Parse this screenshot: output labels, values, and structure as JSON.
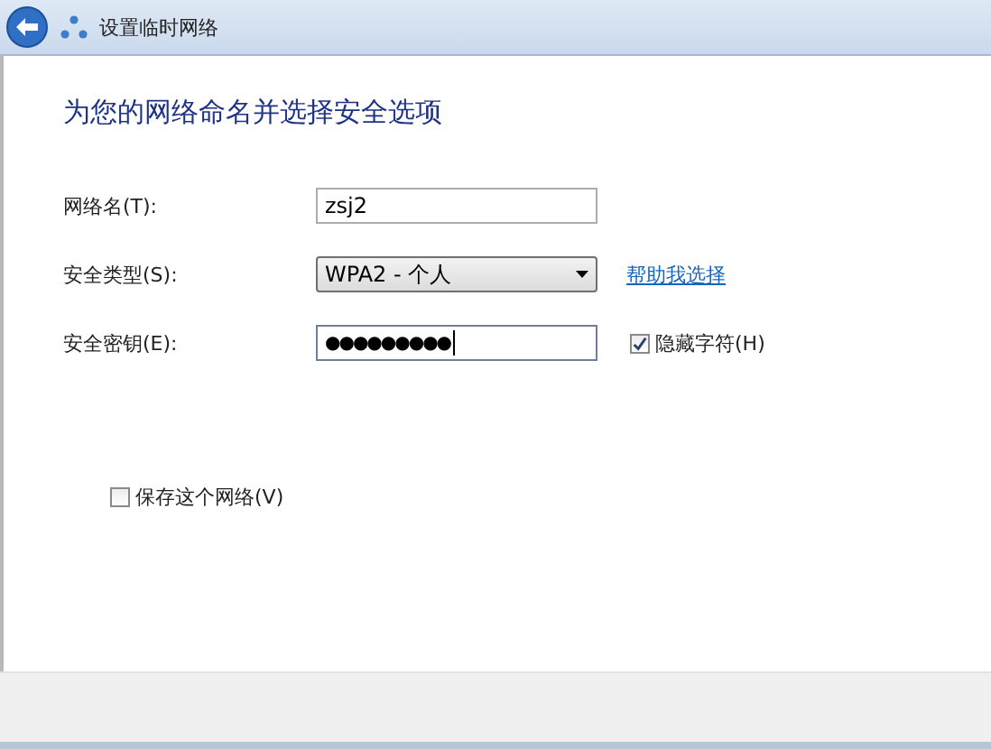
{
  "window": {
    "title": "设置临时网络"
  },
  "heading": "为您的网络命名并选择安全选项",
  "fields": [
    {
      "kind": "text",
      "label": "网络名(T):",
      "value": "zsj2",
      "focused": false
    },
    {
      "kind": "dropdown",
      "label": "安全类型(S):",
      "value": "WPA2 - 个人",
      "link": "帮助我选择"
    },
    {
      "kind": "password",
      "label": "安全密钥(E):",
      "value": "●●●●●●●●●",
      "focused": true,
      "checkbox": {
        "label": "隐藏字符(H)",
        "checked": true
      }
    }
  ],
  "save_network": {
    "label": "保存这个网络(V)",
    "checked": false
  }
}
